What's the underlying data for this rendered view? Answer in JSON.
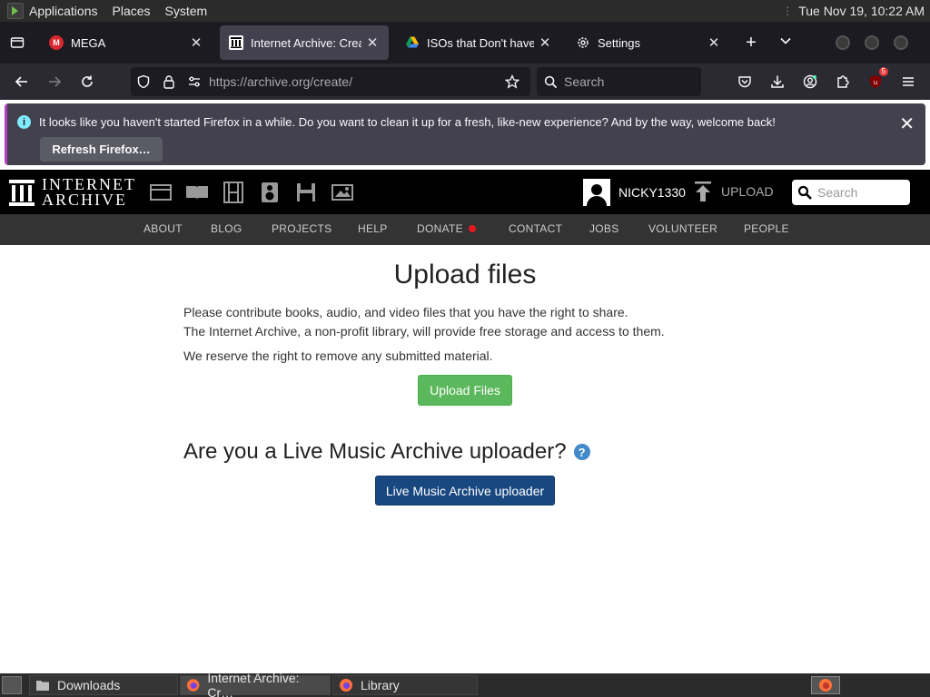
{
  "panel": {
    "menus": [
      "Applications",
      "Places",
      "System"
    ],
    "clock": "Tue Nov 19, 10:22 AM"
  },
  "tabs": [
    {
      "title": "MEGA",
      "favicon": "mega-logo-icon",
      "active": false
    },
    {
      "title": "Internet Archive: Crea",
      "favicon": "internet-archive-icon",
      "active": true
    },
    {
      "title": "ISOs that Don't haven",
      "favicon": "google-drive-icon",
      "active": false
    },
    {
      "title": "Settings",
      "favicon": "gear-icon",
      "active": false
    }
  ],
  "navbar": {
    "url_host": "https://archive.org",
    "url_path": "/create/",
    "search_placeholder": "Search",
    "extension_badge": "5"
  },
  "notification": {
    "message": "It looks like you haven't started Firefox in a while. Do you want to clean it up for a fresh, like-new experience? And by the way, welcome back!",
    "button": "Refresh Firefox…"
  },
  "ia": {
    "logo_line1": "INTERNET",
    "logo_line2": "ARCHIVE",
    "username": "NICKY1330",
    "upload_label": "UPLOAD",
    "search_placeholder": "Search",
    "subnav": [
      "ABOUT",
      "BLOG",
      "PROJECTS",
      "HELP",
      "DONATE",
      "CONTACT",
      "JOBS",
      "VOLUNTEER",
      "PEOPLE"
    ]
  },
  "main": {
    "title": "Upload files",
    "line1": "Please contribute books, audio, and video files that you have the right to share.",
    "line2": "The Internet Archive, a non-profit library, will provide free storage and access to them.",
    "line3": "We reserve the right to remove any submitted material.",
    "upload_button": "Upload Files",
    "lma_heading": "Are you a Live Music Archive uploader?",
    "help_glyph": "?",
    "lma_button": "Live Music Archive uploader"
  },
  "taskbar": {
    "items": [
      "Downloads",
      "Internet Archive: Cr…",
      "Library"
    ]
  },
  "colors": {
    "upload_green": "#5cb85c",
    "lma_blue": "#194880",
    "donate_dot": "#e5181f"
  }
}
